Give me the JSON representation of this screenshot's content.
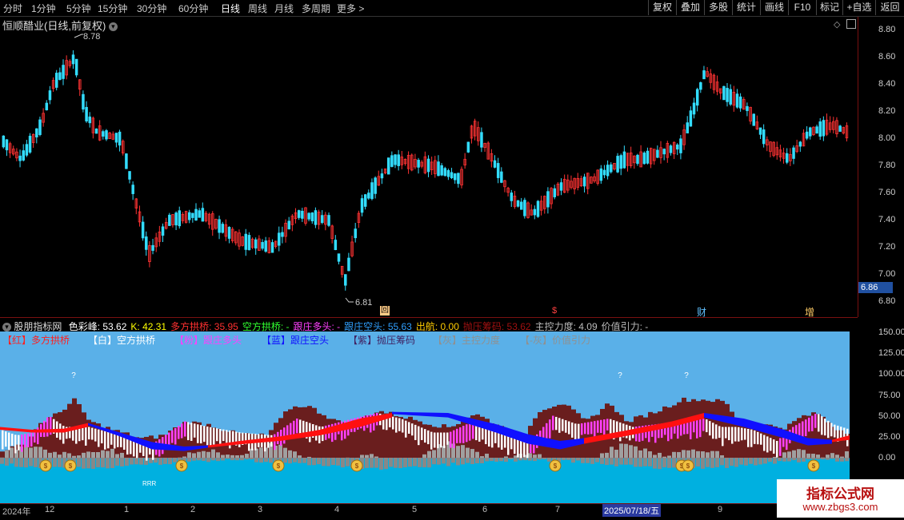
{
  "toolbar": {
    "periods": [
      "分时",
      "1分钟",
      "5分钟",
      "15分钟",
      "30分钟",
      "60分钟",
      "日线",
      "周线",
      "月线",
      "多周期",
      "更多 >"
    ],
    "active_period": "日线",
    "right_buttons": [
      "复权",
      "叠加",
      "多股",
      "统计",
      "画线",
      "F10",
      "标记",
      "+自选",
      "返回"
    ]
  },
  "chart_header": {
    "title": "恒顺醋业(日线,前复权)",
    "high_mark": "8.78",
    "low_mark": "6.81",
    "price_tag": "6.86"
  },
  "price_axis": [
    "8.80",
    "8.60",
    "8.40",
    "8.20",
    "8.00",
    "7.80",
    "7.60",
    "7.40",
    "7.20",
    "7.00",
    "6.80"
  ],
  "event_markers": [
    "回",
    "$",
    "财",
    "增"
  ],
  "indicator": {
    "name": "股朋指标网",
    "values": [
      {
        "label": "色彩峰: ",
        "value": "53.62",
        "color": "#ffffff"
      },
      {
        "label": "K: ",
        "value": "42.31",
        "color": "#ffff00"
      },
      {
        "label": "多方拱桥: ",
        "value": "35.95",
        "color": "#ff3030"
      },
      {
        "label": "空方拱桥: ",
        "value": "-",
        "color": "#30ff30"
      },
      {
        "label": "跟庄多头: ",
        "value": "-",
        "color": "#ff40ff"
      },
      {
        "label": "跟庄空头: ",
        "value": "55.63",
        "color": "#30a0ff"
      },
      {
        "label": "出航: ",
        "value": "0.00",
        "color": "#ffcc00"
      },
      {
        "label": "抛压筹码: ",
        "value": "53.62",
        "color": "#a01010"
      },
      {
        "label": "主控力度: ",
        "value": "4.09",
        "color": "#bbbbbb"
      },
      {
        "label": "价值引力: ",
        "value": "-",
        "color": "#bbbbbb"
      }
    ],
    "legend": [
      {
        "tag": "【红】",
        "text": "多方拱桥",
        "color": "#ff2020"
      },
      {
        "tag": "【白】",
        "text": "空方拱桥",
        "color": "#ffffff"
      },
      {
        "tag": "【粉】",
        "text": "跟庄多头",
        "color": "#ff40ff"
      },
      {
        "tag": "【蓝】",
        "text": "跟庄空头",
        "color": "#1010ff"
      },
      {
        "tag": "【紫】",
        "text": "抛压筹码",
        "color": "#402060"
      },
      {
        "tag": "【灰】",
        "text": "主控力度",
        "color": "#909090"
      },
      {
        "tag": "【-灰】",
        "text": "价值引力",
        "color": "#909090"
      }
    ],
    "axis": [
      "150.00",
      "125.00",
      "100.00",
      "75.00",
      "50.00",
      "25.00",
      "0.00"
    ],
    "question_mark": "?",
    "small_label": "RRR"
  },
  "time_axis": [
    "2024年",
    "12",
    "1",
    "2",
    "3",
    "4",
    "5",
    "6",
    "7",
    "2025/07/18/五",
    "9"
  ],
  "watermark": {
    "title": "指标公式网",
    "url": "www.zbgs3.com"
  },
  "colors": {
    "up": "#ff3333",
    "down": "#33ddff",
    "sky": "#5ab0e8",
    "cyan": "#00b0e0",
    "maroon": "#6a1e1e"
  }
}
